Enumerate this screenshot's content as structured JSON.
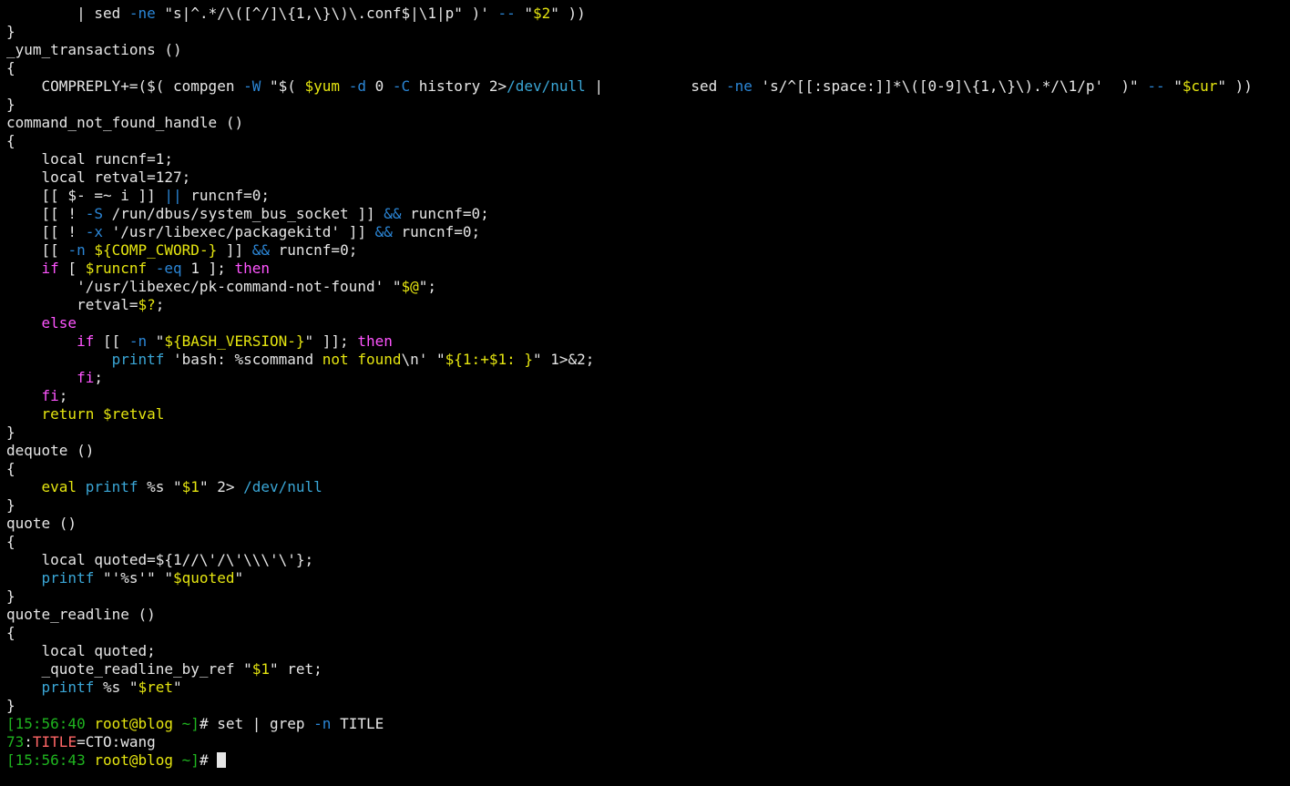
{
  "colors": {
    "background": "#000000",
    "text": "#e6e6e6",
    "keyword": "#ff55ff",
    "builtin": "#3aa6d6",
    "string": "#e5e510",
    "operator": "#2b86d6",
    "prompt": "#1fb41f",
    "user_host": "#e5e510",
    "error_label": "#ff6666"
  },
  "terminal": {
    "cursor_icon": "block-cursor",
    "lines": [
      [
        {
          "t": "        | "
        },
        {
          "t": "sed",
          "c": "text"
        },
        {
          "t": " "
        },
        {
          "t": "-ne",
          "c": "operator"
        },
        {
          "t": " \"s|^.*/\\([^/]\\{1,\\}\\)\\.conf$|\\1|p\" )' "
        },
        {
          "t": "--",
          "c": "operator"
        },
        {
          "t": " \""
        },
        {
          "t": "$2",
          "c": "string"
        },
        {
          "t": "\" ))"
        }
      ],
      [
        {
          "t": "}"
        }
      ],
      [
        {
          "t": "_yum_transactions ()"
        }
      ],
      [
        {
          "t": "{"
        }
      ],
      [
        {
          "t": "    COMPREPLY+=($( compgen "
        },
        {
          "t": "-W",
          "c": "operator"
        },
        {
          "t": " \"$( "
        },
        {
          "t": "$yum",
          "c": "string"
        },
        {
          "t": " "
        },
        {
          "t": "-d",
          "c": "operator"
        },
        {
          "t": " 0 "
        },
        {
          "t": "-C",
          "c": "operator"
        },
        {
          "t": " history 2>"
        },
        {
          "t": "/dev/null",
          "c": "builtin"
        },
        {
          "t": " |          sed "
        },
        {
          "t": "-ne",
          "c": "operator"
        },
        {
          "t": " 's/^[[:space:]]*\\([0-9]\\{1,\\}\\).*/\\1/p'  )\" "
        },
        {
          "t": "--",
          "c": "operator"
        },
        {
          "t": " \""
        },
        {
          "t": "$cur",
          "c": "string"
        },
        {
          "t": "\" ))"
        }
      ],
      [
        {
          "t": "}"
        }
      ],
      [
        {
          "t": "command_not_found_handle ()"
        }
      ],
      [
        {
          "t": "{"
        }
      ],
      [
        {
          "t": "    local runcnf=1;"
        }
      ],
      [
        {
          "t": "    local retval=127;"
        }
      ],
      [
        {
          "t": "    [[ $- =~ i ]] "
        },
        {
          "t": "||",
          "c": "operator"
        },
        {
          "t": " runcnf=0;"
        }
      ],
      [
        {
          "t": "    [[ ! "
        },
        {
          "t": "-S",
          "c": "operator"
        },
        {
          "t": " /run/dbus/system_bus_socket ]] "
        },
        {
          "t": "&&",
          "c": "operator"
        },
        {
          "t": " runcnf=0;"
        }
      ],
      [
        {
          "t": "    [[ ! "
        },
        {
          "t": "-x",
          "c": "operator"
        },
        {
          "t": " '/usr/libexec/packagekitd' ]] "
        },
        {
          "t": "&&",
          "c": "operator"
        },
        {
          "t": " runcnf=0;"
        }
      ],
      [
        {
          "t": "    [[ "
        },
        {
          "t": "-n",
          "c": "operator"
        },
        {
          "t": " "
        },
        {
          "t": "${COMP_CWORD-}",
          "c": "string"
        },
        {
          "t": " ]] "
        },
        {
          "t": "&&",
          "c": "operator"
        },
        {
          "t": " runcnf=0;"
        }
      ],
      [
        {
          "t": "    "
        },
        {
          "t": "if",
          "c": "keyword"
        },
        {
          "t": " [ "
        },
        {
          "t": "$runcnf",
          "c": "string"
        },
        {
          "t": " "
        },
        {
          "t": "-eq",
          "c": "operator"
        },
        {
          "t": " 1 ]; "
        },
        {
          "t": "then",
          "c": "keyword"
        }
      ],
      [
        {
          "t": "        '/usr/libexec/pk-command-not-found' \""
        },
        {
          "t": "$@",
          "c": "string"
        },
        {
          "t": "\";"
        }
      ],
      [
        {
          "t": "        retval="
        },
        {
          "t": "$?",
          "c": "string"
        },
        {
          "t": ";"
        }
      ],
      [
        {
          "t": "    "
        },
        {
          "t": "else",
          "c": "keyword"
        }
      ],
      [
        {
          "t": "        "
        },
        {
          "t": "if",
          "c": "keyword"
        },
        {
          "t": " [[ "
        },
        {
          "t": "-n",
          "c": "operator"
        },
        {
          "t": " \""
        },
        {
          "t": "${BASH_VERSION-}",
          "c": "string"
        },
        {
          "t": "\" ]]; "
        },
        {
          "t": "then",
          "c": "keyword"
        }
      ],
      [
        {
          "t": "            "
        },
        {
          "t": "printf",
          "c": "builtin"
        },
        {
          "t": " 'bash: %scommand "
        },
        {
          "t": "not found",
          "c": "string"
        },
        {
          "t": "\\n' \""
        },
        {
          "t": "${1:+$1: }",
          "c": "string"
        },
        {
          "t": "\" 1>&2;"
        }
      ],
      [
        {
          "t": "        "
        },
        {
          "t": "fi",
          "c": "keyword"
        },
        {
          "t": ";"
        }
      ],
      [
        {
          "t": "    "
        },
        {
          "t": "fi",
          "c": "keyword"
        },
        {
          "t": ";"
        }
      ],
      [
        {
          "t": "    "
        },
        {
          "t": "return",
          "c": "string"
        },
        {
          "t": " "
        },
        {
          "t": "$retval",
          "c": "string"
        }
      ],
      [
        {
          "t": "}"
        }
      ],
      [
        {
          "t": "dequote ()"
        }
      ],
      [
        {
          "t": "{"
        }
      ],
      [
        {
          "t": "    "
        },
        {
          "t": "eval",
          "c": "string"
        },
        {
          "t": " "
        },
        {
          "t": "printf",
          "c": "builtin"
        },
        {
          "t": " %s \""
        },
        {
          "t": "$1",
          "c": "string"
        },
        {
          "t": "\" 2> "
        },
        {
          "t": "/dev/null",
          "c": "builtin"
        }
      ],
      [
        {
          "t": "}"
        }
      ],
      [
        {
          "t": "quote ()"
        }
      ],
      [
        {
          "t": "{"
        }
      ],
      [
        {
          "t": "    local quoted=${1//\\'/\\'\\\\\\'\\'};"
        }
      ],
      [
        {
          "t": "    "
        },
        {
          "t": "printf",
          "c": "builtin"
        },
        {
          "t": " \"'%s'\" \""
        },
        {
          "t": "$quoted",
          "c": "string"
        },
        {
          "t": "\""
        }
      ],
      [
        {
          "t": "}"
        }
      ],
      [
        {
          "t": "quote_readline ()"
        }
      ],
      [
        {
          "t": "{"
        }
      ],
      [
        {
          "t": "    local quoted;"
        }
      ],
      [
        {
          "t": "    _quote_readline_by_ref \""
        },
        {
          "t": "$1",
          "c": "string"
        },
        {
          "t": "\" ret;"
        }
      ],
      [
        {
          "t": "    "
        },
        {
          "t": "printf",
          "c": "builtin"
        },
        {
          "t": " %s \""
        },
        {
          "t": "$ret",
          "c": "string"
        },
        {
          "t": "\""
        }
      ],
      [
        {
          "t": "}"
        }
      ],
      [
        {
          "t": "[15:56:40 ",
          "c": "prompt"
        },
        {
          "t": "root@blog",
          "c": "user_host"
        },
        {
          "t": " ~]",
          "c": "prompt"
        },
        {
          "t": "# set | grep "
        },
        {
          "t": "-n",
          "c": "operator"
        },
        {
          "t": " TITLE"
        }
      ],
      [
        {
          "t": "73",
          "c": "prompt"
        },
        {
          "t": ":"
        },
        {
          "t": "TITLE",
          "c": "error_label"
        },
        {
          "t": "=CTO:wang"
        }
      ],
      [
        {
          "t": "[15:56:43 ",
          "c": "prompt"
        },
        {
          "t": "root@blog",
          "c": "user_host"
        },
        {
          "t": " ~]",
          "c": "prompt"
        },
        {
          "t": "# "
        }
      ]
    ]
  }
}
